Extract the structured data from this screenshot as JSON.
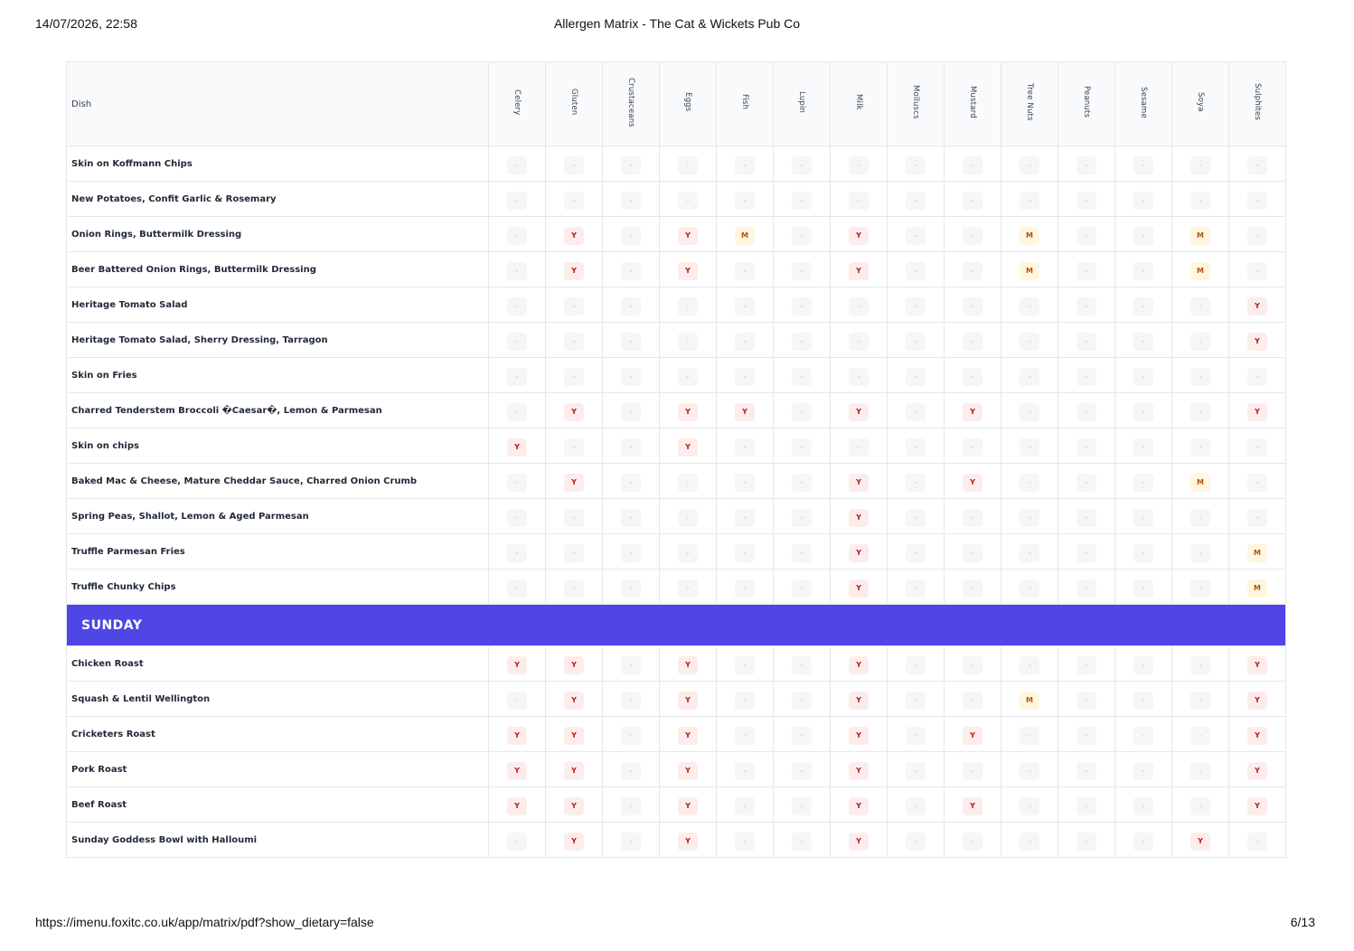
{
  "print_header": {
    "date": "14/07/2026, 22:58",
    "title": "Allergen Matrix - The Cat & Wickets Pub Co"
  },
  "print_footer": {
    "url": "https://imenu.foxitc.co.uk/app/matrix/pdf?show_dietary=false",
    "page": "6/13"
  },
  "table": {
    "dish_header": "Dish",
    "allergens": [
      "Celery",
      "Gluten",
      "Crustaceans",
      "Eggs",
      "Fish",
      "Lupin",
      "Milk",
      "Molluscs",
      "Mustard",
      "Tree Nuts",
      "Peanuts",
      "Sesame",
      "Soya",
      "Sulphites"
    ],
    "rows": [
      {
        "dish": "Skin on Koffmann Chips",
        "v": [
          "-",
          "-",
          "-",
          "-",
          "-",
          "-",
          "-",
          "-",
          "-",
          "-",
          "-",
          "-",
          "-",
          "-"
        ]
      },
      {
        "dish": "New Potatoes, Confit Garlic & Rosemary",
        "v": [
          "-",
          "-",
          "-",
          "-",
          "-",
          "-",
          "-",
          "-",
          "-",
          "-",
          "-",
          "-",
          "-",
          "-"
        ]
      },
      {
        "dish": "Onion Rings, Buttermilk Dressing",
        "v": [
          "-",
          "Y",
          "-",
          "Y",
          "M",
          "-",
          "Y",
          "-",
          "-",
          "M",
          "-",
          "-",
          "M",
          "-"
        ]
      },
      {
        "dish": "Beer Battered Onion Rings, Buttermilk Dressing",
        "v": [
          "-",
          "Y",
          "-",
          "Y",
          "-",
          "-",
          "Y",
          "-",
          "-",
          "M",
          "-",
          "-",
          "M",
          "-"
        ]
      },
      {
        "dish": "Heritage Tomato Salad",
        "v": [
          "-",
          "-",
          "-",
          "-",
          "-",
          "-",
          "-",
          "-",
          "-",
          "-",
          "-",
          "-",
          "-",
          "Y"
        ]
      },
      {
        "dish": "Heritage Tomato Salad, Sherry Dressing, Tarragon",
        "v": [
          "-",
          "-",
          "-",
          "-",
          "-",
          "-",
          "-",
          "-",
          "-",
          "-",
          "-",
          "-",
          "-",
          "Y"
        ]
      },
      {
        "dish": "Skin on Fries",
        "v": [
          "-",
          "-",
          "-",
          "-",
          "-",
          "-",
          "-",
          "-",
          "-",
          "-",
          "-",
          "-",
          "-",
          "-"
        ]
      },
      {
        "dish": "Charred Tenderstem Broccoli �Caesar�, Lemon & Parmesan",
        "v": [
          "-",
          "Y",
          "-",
          "Y",
          "Y",
          "-",
          "Y",
          "-",
          "Y",
          "-",
          "-",
          "-",
          "-",
          "Y"
        ]
      },
      {
        "dish": "Skin on chips",
        "v": [
          "Y",
          "-",
          "-",
          "Y",
          "-",
          "-",
          "-",
          "-",
          "-",
          "-",
          "-",
          "-",
          "-",
          "-"
        ]
      },
      {
        "dish": "Baked Mac & Cheese, Mature Cheddar Sauce, Charred Onion Crumb",
        "v": [
          "-",
          "Y",
          "-",
          "-",
          "-",
          "-",
          "Y",
          "-",
          "Y",
          "-",
          "-",
          "-",
          "M",
          "-"
        ]
      },
      {
        "dish": "Spring Peas, Shallot, Lemon & Aged Parmesan",
        "v": [
          "-",
          "-",
          "-",
          "-",
          "-",
          "-",
          "Y",
          "-",
          "-",
          "-",
          "-",
          "-",
          "-",
          "-"
        ]
      },
      {
        "dish": "Truffle Parmesan Fries",
        "v": [
          "-",
          "-",
          "-",
          "-",
          "-",
          "-",
          "Y",
          "-",
          "-",
          "-",
          "-",
          "-",
          "-",
          "M"
        ]
      },
      {
        "dish": "Truffle Chunky Chips",
        "v": [
          "-",
          "-",
          "-",
          "-",
          "-",
          "-",
          "Y",
          "-",
          "-",
          "-",
          "-",
          "-",
          "-",
          "M"
        ]
      }
    ],
    "section_title": "SUNDAY",
    "section_rows": [
      {
        "dish": "Chicken Roast",
        "v": [
          "Y",
          "Y",
          "-",
          "Y",
          "-",
          "-",
          "Y",
          "-",
          "-",
          "-",
          "-",
          "-",
          "-",
          "Y"
        ]
      },
      {
        "dish": "Squash & Lentil Wellington",
        "v": [
          "-",
          "Y",
          "-",
          "Y",
          "-",
          "-",
          "Y",
          "-",
          "-",
          "M",
          "-",
          "-",
          "-",
          "Y"
        ]
      },
      {
        "dish": "Cricketers Roast",
        "v": [
          "Y",
          "Y",
          "-",
          "Y",
          "-",
          "-",
          "Y",
          "-",
          "Y",
          "-",
          "-",
          "-",
          "-",
          "Y"
        ]
      },
      {
        "dish": "Pork Roast",
        "v": [
          "Y",
          "Y",
          "-",
          "Y",
          "-",
          "-",
          "Y",
          "-",
          "-",
          "-",
          "-",
          "-",
          "-",
          "Y"
        ]
      },
      {
        "dish": "Beef Roast",
        "v": [
          "Y",
          "Y",
          "-",
          "Y",
          "-",
          "-",
          "Y",
          "-",
          "Y",
          "-",
          "-",
          "-",
          "-",
          "Y"
        ]
      },
      {
        "dish": "Sunday Goddess Bowl with Halloumi",
        "v": [
          "-",
          "Y",
          "-",
          "Y",
          "-",
          "-",
          "Y",
          "-",
          "-",
          "-",
          "-",
          "-",
          "Y",
          "-"
        ]
      }
    ]
  },
  "colors": {
    "section_bg": "#4f46e5",
    "yes_bg": "#fdecec",
    "yes_text": "#b91c1c",
    "may_bg": "#fff6e0",
    "may_text": "#b45309"
  }
}
